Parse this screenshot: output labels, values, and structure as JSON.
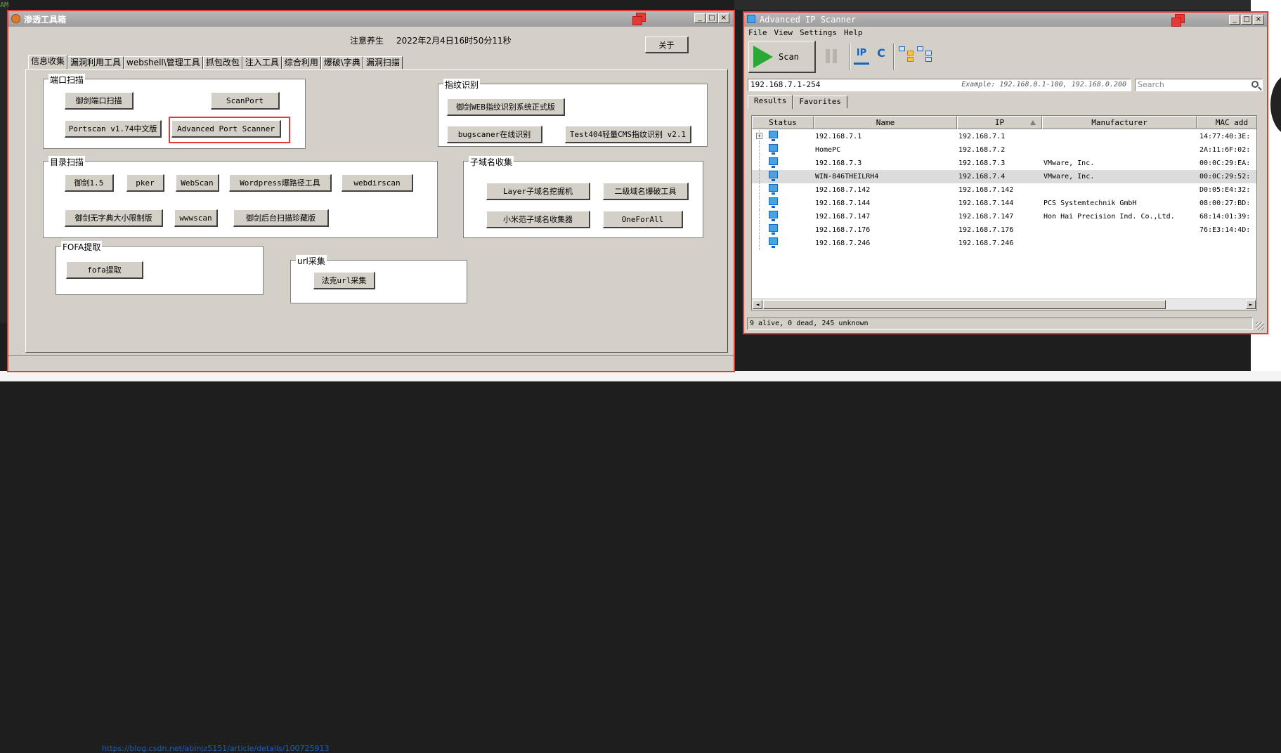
{
  "background": {
    "terminal_lines": [
      "AMPLES:",
      "",
      "",
      "",
      "",
      "",
      "",
      "",
      "",
      "",
      "",
      "",
      "",
      "",
      "",
      "",
      "",
      "",
      "",
      "",
      "",
      "",
      "",
      "",
      "",
      ""
    ],
    "link_text": "https://blog.csdn.net/abinjz5151/article/details/100725913"
  },
  "win1": {
    "title": "渗透工具箱",
    "notice": "注意养生",
    "datetime": "2022年2月4日16时50分11秒",
    "about_label": "关于",
    "controls": {
      "min": "_",
      "max": "□",
      "close": "×"
    },
    "tabs": [
      "信息收集",
      "漏洞利用工具",
      "webshell\\管理工具",
      "抓包改包",
      "注入工具",
      "综合利用",
      "爆破\\字典",
      "漏洞扫描"
    ],
    "groups": {
      "port_scan": {
        "title": "端口扫描",
        "buttons": [
          "御剑端口扫描",
          "ScanPort",
          "Portscan v1.74中文版",
          "Advanced Port Scanner"
        ]
      },
      "fingerprint": {
        "title": "指纹识别",
        "buttons": [
          "御剑WEB指纹识别系统正式版",
          "bugscaner在线识别",
          "Test404轻量CMS指纹识别 v2.1"
        ]
      },
      "dir_scan": {
        "title": "目录扫描",
        "buttons": [
          "御剑1.5",
          "pker",
          "WebScan",
          "Wordpress爆路径工具",
          "webdirscan",
          "御剑无字典大小限制版",
          "wwwscan",
          "御剑后台扫描珍藏版"
        ]
      },
      "subdomain": {
        "title": "子域名收集",
        "buttons": [
          "Layer子域名挖掘机",
          "二级域名爆破工具",
          "小米范子域名收集器",
          "OneForAll"
        ]
      },
      "fofa": {
        "title": "FOFA提取",
        "buttons": [
          "fofa提取"
        ]
      },
      "url": {
        "title": "url采集",
        "buttons": [
          "法克url采集"
        ]
      }
    }
  },
  "win2": {
    "title": "Advanced IP Scanner",
    "controls": {
      "min": "_",
      "max": "□",
      "close": "×"
    },
    "menu": [
      "File",
      "View",
      "Settings",
      "Help"
    ],
    "scan_label": "Scan",
    "ip_icon_label": "IP",
    "c_icon_label": "C",
    "range_value": "192.168.7.1-254",
    "range_example": "Example: 192.168.0.1-100, 192.168.0.200",
    "search_placeholder": "Search",
    "tabs": [
      "Results",
      "Favorites"
    ],
    "columns": [
      "Status",
      "Name",
      "IP",
      "Manufacturer",
      "MAC add"
    ],
    "rows": [
      {
        "name": "192.168.7.1",
        "ip": "192.168.7.1",
        "mfr": "",
        "mac": "14:77:40:3E:",
        "expander": "+"
      },
      {
        "name": "HomePC",
        "ip": "192.168.7.2",
        "mfr": "",
        "mac": "2A:11:6F:02:"
      },
      {
        "name": "192.168.7.3",
        "ip": "192.168.7.3",
        "mfr": "VMware, Inc.",
        "mac": "00:0C:29:EA:"
      },
      {
        "name": "WIN-846THEILRH4",
        "ip": "192.168.7.4",
        "mfr": "VMware, Inc.",
        "mac": "00:0C:29:52:"
      },
      {
        "name": "192.168.7.142",
        "ip": "192.168.7.142",
        "mfr": "",
        "mac": "D0:05:E4:32:"
      },
      {
        "name": "192.168.7.144",
        "ip": "192.168.7.144",
        "mfr": "PCS Systemtechnik GmbH",
        "mac": "08:00:27:BD:"
      },
      {
        "name": "192.168.7.147",
        "ip": "192.168.7.147",
        "mfr": "Hon Hai Precision Ind. Co.,Ltd.",
        "mac": "68:14:01:39:"
      },
      {
        "name": "192.168.7.176",
        "ip": "192.168.7.176",
        "mfr": "",
        "mac": "76:E3:14:4D:"
      },
      {
        "name": "192.168.7.246",
        "ip": "192.168.7.246",
        "mfr": "",
        "mac": ""
      }
    ],
    "status_text": "9 alive, 0 dead, 245 unknown"
  }
}
